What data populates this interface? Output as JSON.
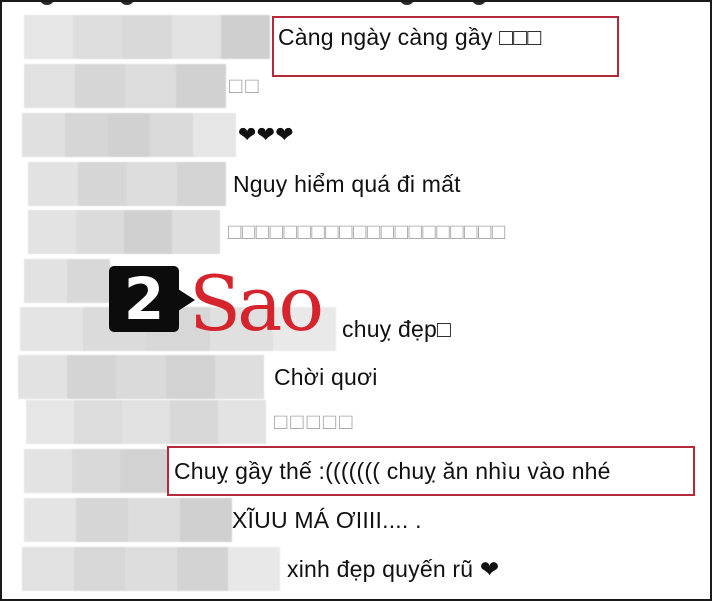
{
  "comments": [
    {
      "text": "Càng ngày càng gầy □□□",
      "highlighted": true
    },
    {
      "text": "□□",
      "highlighted": false
    },
    {
      "text": "❤❤❤",
      "highlighted": false
    },
    {
      "text": "Nguy hiểm quá đi mất",
      "highlighted": false
    },
    {
      "text": "□□□□□□□□□□□□□□□□□□□□",
      "highlighted": false
    },
    {
      "text": "",
      "highlighted": false
    },
    {
      "text": "chuỵ đẹp□",
      "highlighted": false
    },
    {
      "text": "Chời quơi",
      "highlighted": false
    },
    {
      "text": "□□□□□",
      "highlighted": false
    },
    {
      "text": "Chuỵ gầy thế :((((((( chuỵ ăn nhìu vào nhé",
      "highlighted": true
    },
    {
      "text": "XĨUU MÁ ƠIIII.... .",
      "highlighted": false
    },
    {
      "text": "xinh đẹp quyến rũ ❤",
      "highlighted": false
    }
  ],
  "watermark": {
    "number": "2",
    "brand": "Sao"
  },
  "colors": {
    "highlight_border": "#b52a3a",
    "watermark_red": "#d6242d"
  }
}
